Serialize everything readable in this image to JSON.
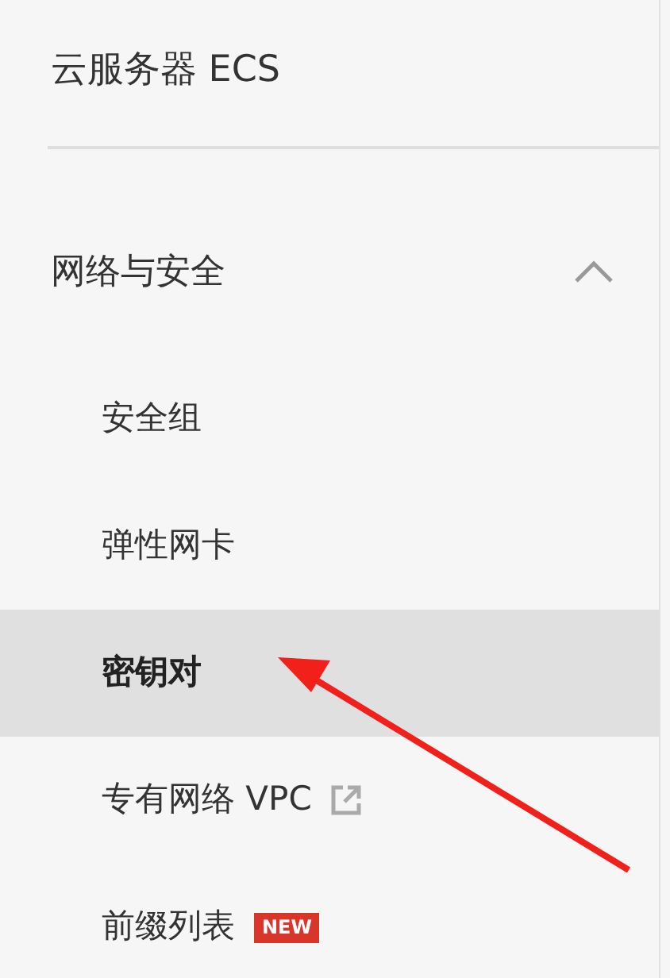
{
  "title": "云服务器 ECS",
  "section": {
    "label": "网络与安全",
    "expanded": true,
    "items": [
      {
        "label": "安全组",
        "selected": false
      },
      {
        "label": "弹性网卡",
        "selected": false
      },
      {
        "label": "密钥对",
        "selected": true
      },
      {
        "label": "专有网络 VPC",
        "selected": false,
        "external": true
      },
      {
        "label": "前缀列表",
        "selected": false,
        "badge": "NEW"
      }
    ]
  }
}
